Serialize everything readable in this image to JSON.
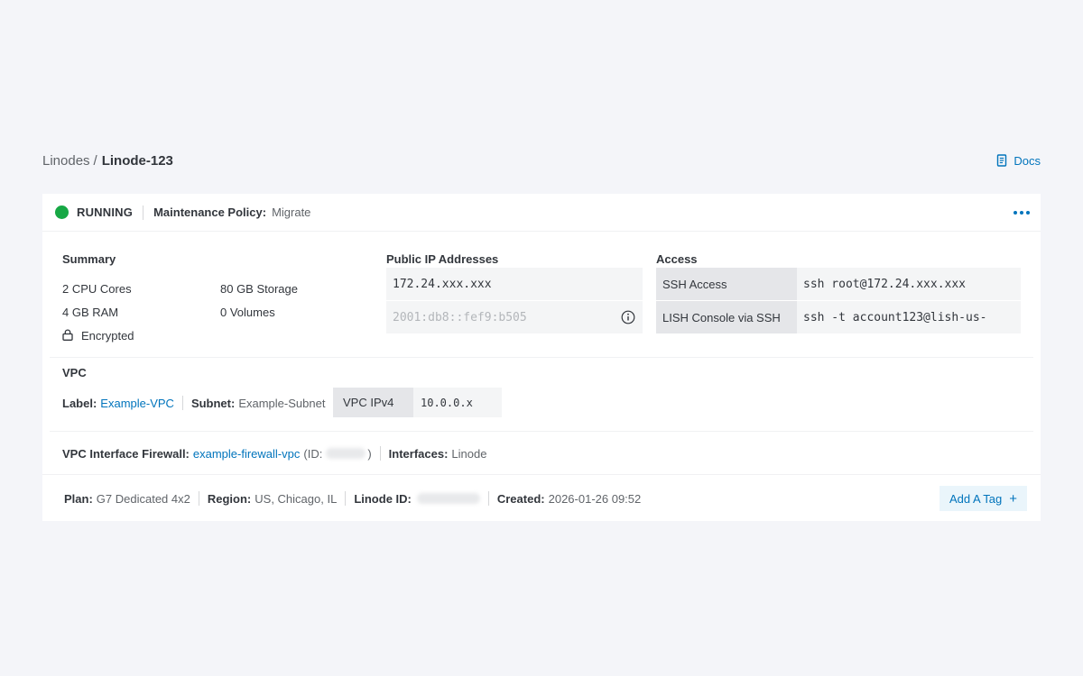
{
  "breadcrumb": {
    "parent": "Linodes",
    "separator": "/",
    "current": "Linode-123"
  },
  "docs": {
    "label": "Docs"
  },
  "status": {
    "text": "RUNNING",
    "color": "#17a845"
  },
  "maintenance": {
    "label": "Maintenance Policy:",
    "value": "Migrate"
  },
  "summary": {
    "title": "Summary",
    "cpu": "2 CPU Cores",
    "storage": "80 GB Storage",
    "ram": "4 GB RAM",
    "volumes": "0 Volumes",
    "encrypted": "Encrypted"
  },
  "public_ip": {
    "title": "Public IP Addresses",
    "ipv4": "172.24.xxx.xxx",
    "ipv6": "2001:db8::fef9:b505"
  },
  "access": {
    "title": "Access",
    "rows": [
      {
        "label": "SSH Access",
        "value": "ssh root@172.24.xxx.xxx"
      },
      {
        "label": "LISH Console via SSH",
        "value": "ssh -t account123@lish-us-"
      }
    ]
  },
  "vpc": {
    "title": "VPC",
    "label_key": "Label:",
    "label_value": "Example-VPC",
    "subnet_key": "Subnet:",
    "subnet_value": "Example-Subnet",
    "ipv4_label": "VPC IPv4",
    "ipv4_value": "10.0.0.x"
  },
  "firewall": {
    "key": "VPC Interface Firewall:",
    "value": "example-firewall-vpc",
    "id_open": "(ID:",
    "id_close": ")",
    "interfaces_key": "Interfaces:",
    "interfaces_value": "Linode"
  },
  "footer": {
    "plan_key": "Plan:",
    "plan_value": "G7 Dedicated 4x2",
    "region_key": "Region:",
    "region_value": "US, Chicago, IL",
    "id_key": "Linode ID:",
    "created_key": "Created:",
    "created_value": "2026-01-26 09:52",
    "add_tag": "Add A Tag",
    "add_tag_icon": "+"
  }
}
